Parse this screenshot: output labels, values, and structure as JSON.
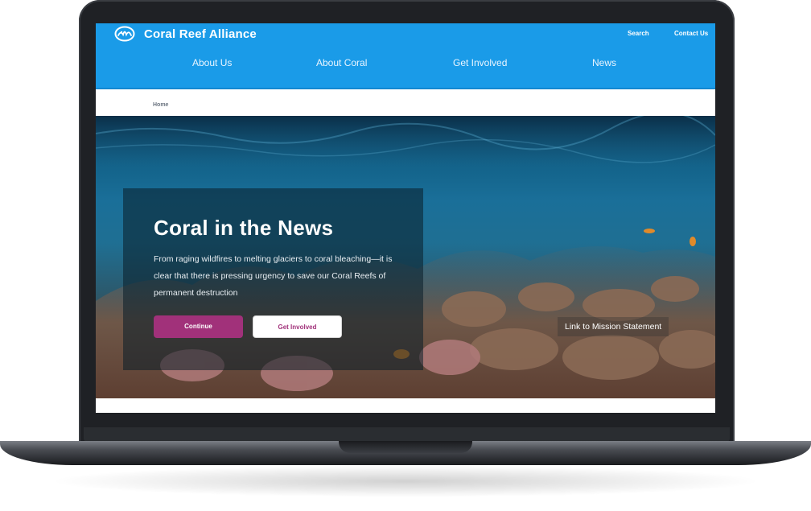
{
  "site": {
    "brand": "Coral Reef Alliance",
    "logo_icon": "coral-reef-alliance-logo-icon"
  },
  "utility_nav": {
    "search": "Search",
    "contact": "Contact Us"
  },
  "main_nav": {
    "items": [
      {
        "label": "About Us"
      },
      {
        "label": "About Coral"
      },
      {
        "label": "Get Involved"
      },
      {
        "label": "News"
      }
    ]
  },
  "breadcrumb": {
    "home": "Home"
  },
  "hero": {
    "title": "Coral in the News",
    "body": "From raging wildfires to melting glaciers to coral bleaching—it is clear that there is pressing urgency to save our Coral Reefs of permanent destruction",
    "continue_label": "Continue",
    "get_involved_label": "Get Involved",
    "mission_link": "Link to Mission Statement"
  },
  "colors": {
    "header_blue": "#1a9be8",
    "button_magenta": "#a1317a",
    "laptop_dark": "#1f2125"
  }
}
